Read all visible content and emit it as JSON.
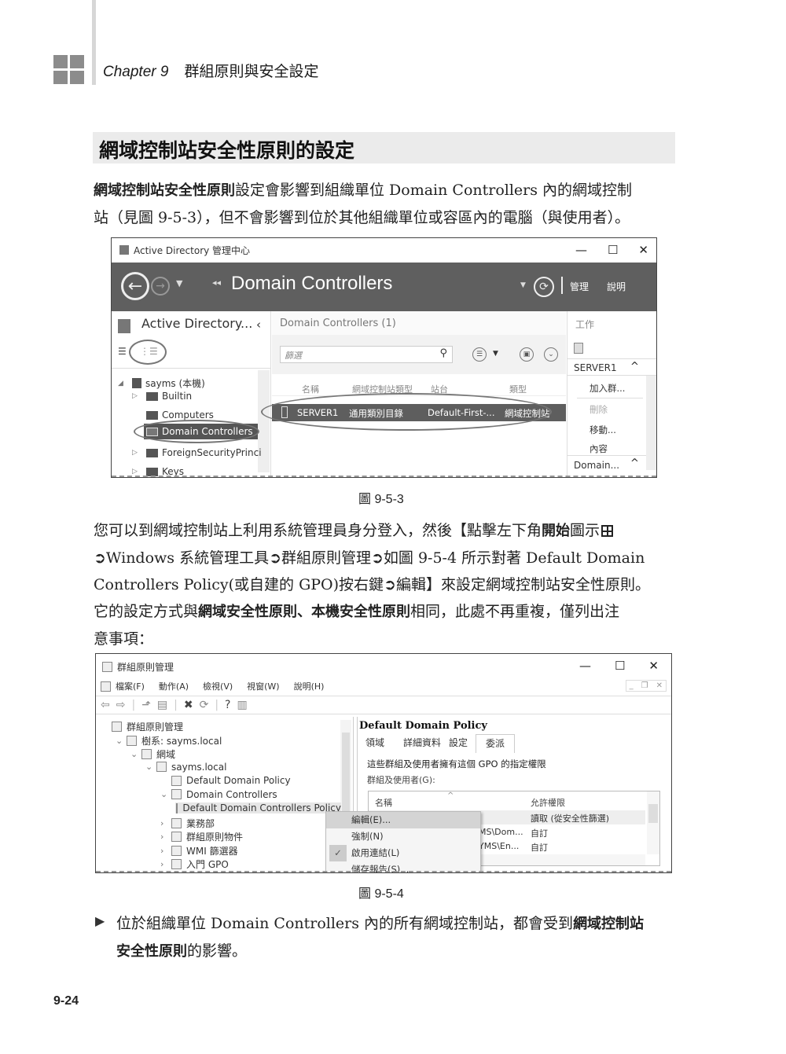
{
  "header": {
    "chapter_label": "Chapter 9",
    "chapter_title": "群組原則與安全設定"
  },
  "section": {
    "title": "網域控制站安全性原則的設定"
  },
  "para1": {
    "bold_lead": "網域控制站安全性原則",
    "line1_rest": "設定會影響到組織單位 Domain Controllers 內的網域控制",
    "line2": "站（見圖 9-5-3），但不會影響到位於其他組織單位或容區內的電腦（與使用者）。"
  },
  "figure1": {
    "caption": "圖 9-5-3",
    "window_title": "Active Directory 管理中心",
    "breadcrumb": "Domain Controllers",
    "header_buttons": [
      "管理",
      "說明"
    ],
    "nav_title": "Active Directory...",
    "tree": [
      {
        "label": "sayms (本機)",
        "expander": "◢"
      },
      {
        "label": "Builtin",
        "expander": "▷"
      },
      {
        "label": "Computers",
        "expander": ""
      },
      {
        "label": "Domain Controllers",
        "expander": "",
        "selected": true
      },
      {
        "label": "ForeignSecurityPrinci",
        "expander": "▷"
      },
      {
        "label": "Keys",
        "expander": "▷"
      }
    ],
    "list_title": "Domain Controllers  (1)",
    "filter_placeholder": "篩選",
    "columns": [
      "名稱",
      "網域控制站類型",
      "站台",
      "類型"
    ],
    "rows": [
      {
        "name": "SERVER1",
        "dc_type": "通用類別目錄",
        "site": "Default-First-...",
        "type": "網域控制站"
      }
    ],
    "tasks_title": "工作",
    "tasks_section": "SERVER1",
    "tasks": [
      {
        "label": "加入群...",
        "disabled": false
      },
      {
        "label": "刪除",
        "disabled": true
      },
      {
        "label": "移動...",
        "disabled": false
      },
      {
        "label": "內容",
        "disabled": false
      }
    ],
    "tasks_section2": "Domain..."
  },
  "para2": {
    "line1_a": "您可以到網域控制站上利用系統管理員身分登入，然後【點擊左下角",
    "line1_b": "開始",
    "line1_c": "圖示",
    "line2": "➲Windows 系統管理工具➲群組原則管理➲如圖 9-5-4 所示對著 Default Domain",
    "line3": "Controllers Policy(或自建的 GPO)按右鍵➲編輯】來設定網域控制站安全性原則。",
    "line4_a": "它的設定方式與",
    "line4_b": "網域安全性原則、本機安全性原則",
    "line4_c": "相同，此處不再重複，僅列出注",
    "line5": "意事項："
  },
  "figure2": {
    "caption": "圖 9-5-4",
    "window_title": "群組原則管理",
    "menu": [
      "檔案(F)",
      "動作(A)",
      "檢視(V)",
      "視窗(W)",
      "說明(H)"
    ],
    "tree": [
      {
        "label": "群組原則管理",
        "indent": 0,
        "expander": ""
      },
      {
        "label": "樹系: sayms.local",
        "indent": 1,
        "expander": "⌄"
      },
      {
        "label": "網域",
        "indent": 2,
        "expander": "⌄"
      },
      {
        "label": "sayms.local",
        "indent": 3,
        "expander": "⌄"
      },
      {
        "label": "Default Domain Policy",
        "indent": 4,
        "expander": ""
      },
      {
        "label": "Domain Controllers",
        "indent": 4,
        "expander": "⌄"
      },
      {
        "label": "Default Domain Controllers Policy",
        "indent": 5,
        "expander": "",
        "selected": true
      },
      {
        "label": "業務部",
        "indent": 4,
        "expander": "›"
      },
      {
        "label": "群組原則物件",
        "indent": 4,
        "expander": "›"
      },
      {
        "label": "WMI 篩選器",
        "indent": 4,
        "expander": "›"
      },
      {
        "label": "入門 GPO",
        "indent": 4,
        "expander": "›"
      }
    ],
    "detail_title": "Default Domain Policy",
    "tabs": [
      "領域",
      "詳細資料",
      "設定",
      "委派"
    ],
    "active_tab": "委派",
    "desc": "這些群組及使用者擁有這個 GPO 的指定權限",
    "groups_label": "群組及使用者(G):",
    "columns": [
      "名稱",
      "允許權限"
    ],
    "rows": [
      {
        "name": "",
        "perm": "讀取 (從安全性篩選)"
      },
      {
        "name": "MS\\Dom...",
        "perm": "自訂"
      },
      {
        "name": "YMS\\En...",
        "perm": "自訂"
      }
    ],
    "context_menu": [
      {
        "label": "編輯(E)...",
        "highlighted": true,
        "checked": false
      },
      {
        "label": "強制(N)",
        "highlighted": false,
        "checked": false
      },
      {
        "label": "啟用連結(L)",
        "highlighted": false,
        "checked": true
      },
      {
        "label": "儲存報告(S)...",
        "highlighted": false,
        "checked": false
      }
    ]
  },
  "bullet": {
    "line1_a": "位於組織單位 Domain Controllers 內的所有網域控制站，都會受到",
    "line1_b": "網域控制站",
    "line2_a": "安全性原則",
    "line2_b": "的影響。"
  },
  "footer": {
    "page_number": "9-24"
  }
}
